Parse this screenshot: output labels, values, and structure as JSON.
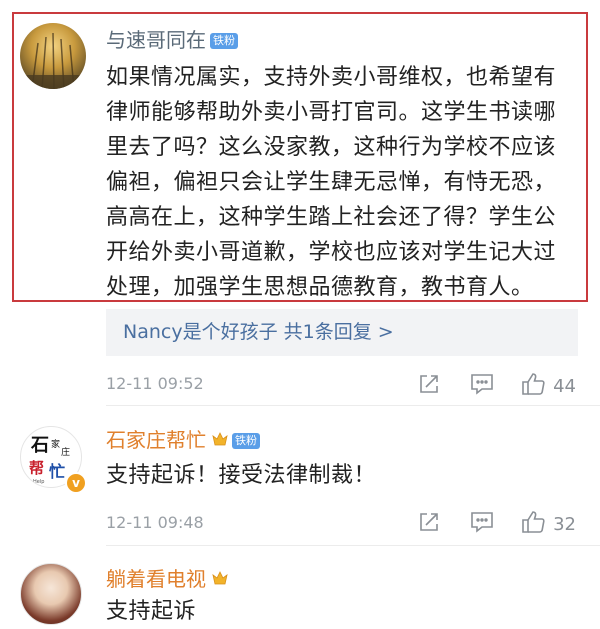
{
  "comments": [
    {
      "username": "与速哥同在",
      "badge": "铁粉",
      "text": "如果情况属实，支持外卖小哥维权，也希望有律师能够帮助外卖小哥打官司。这学生书读哪里去了吗？这么没家教，这种行为学校不应该偏袒，偏袒只会让学生肆无忌惮，有恃无恐，高高在上，这种学生踏上社会还了得？学生公开给外卖小哥道歉，学校也应该对学生记大过处理，加强学生思想品德教育，教书育人。",
      "lines": [
        "如果情况属实，支持外卖小哥维权，也希望有",
        "律师能够帮助外卖小哥打官司。这学生书读哪",
        "里去了吗？这么没家教，这种行为学校不应该",
        "偏袒，偏袒只会让学生肆无忌惮，有恃无恐，",
        "高高在上，这种学生踏上社会还了得？学生公",
        "开给外卖小哥道歉，学校也应该对学生记大过",
        "处理，加强学生思想品德教育，教书育人。"
      ],
      "reply_preview": "Nancy是个好孩子 共1条回复 >",
      "timestamp": "12-11 09:52",
      "like_count": "44"
    },
    {
      "username": "石家庄帮忙",
      "badge": "铁粉",
      "avatar_text": "石家庄 帮忙",
      "text": "支持起诉！接受法律制裁！",
      "timestamp": "12-11 09:48",
      "like_count": "32"
    },
    {
      "username": "躺着看电视",
      "text_partial": "支持起诉"
    }
  ],
  "icons": {
    "share": "share-icon",
    "comment": "comment-icon",
    "like": "thumbs-up-icon",
    "crown": "crown-icon",
    "verified": "verified-v-icon"
  },
  "colors": {
    "highlight_border": "#c93a3e",
    "username_orange": "#e0802d",
    "username_gray": "#5a6a78",
    "badge_blue": "#5a9ee8",
    "reply_link": "#4a6fa0"
  }
}
